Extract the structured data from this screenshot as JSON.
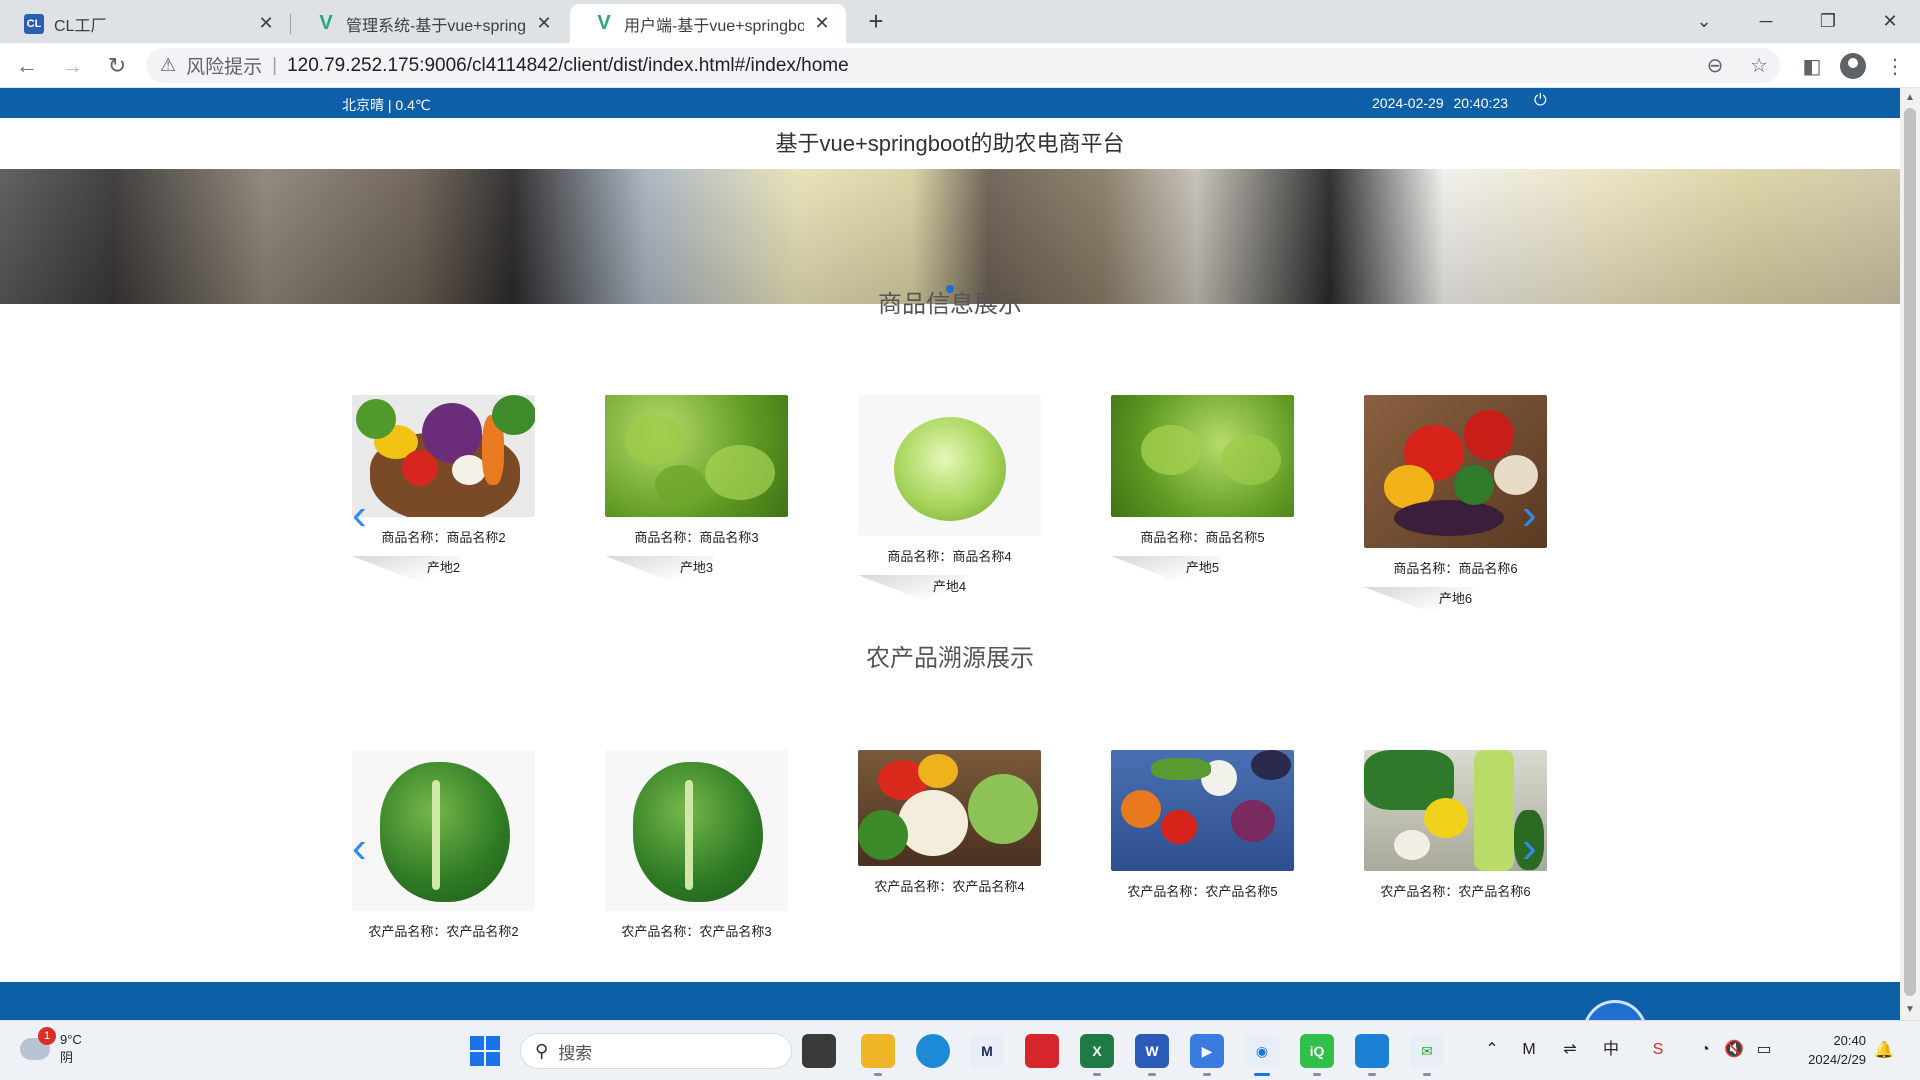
{
  "browser": {
    "tabs": [
      {
        "title": "CL工厂",
        "icon": "cl-logo-icon",
        "active": false
      },
      {
        "title": "管理系统-基于vue+springbo",
        "icon": "vue-logo-icon",
        "active": false
      },
      {
        "title": "用户端-基于vue+springboot",
        "icon": "vue-logo-icon",
        "active": true
      }
    ],
    "warning_label": "风险提示",
    "url": "120.79.252.175:9006/cl4114842/client/dist/index.html#/index/home"
  },
  "page": {
    "weather": "北京晴 | 0.4℃",
    "date": "2024-02-29",
    "time": "20:40:23",
    "site_title": "基于vue+springboot的助农电商平台",
    "products_section": {
      "title": "商品信息展示",
      "items": [
        {
          "name": "商品名称：商品名称2",
          "origin": "产地2"
        },
        {
          "name": "商品名称：商品名称3",
          "origin": "产地3"
        },
        {
          "name": "商品名称：商品名称4",
          "origin": "产地4"
        },
        {
          "name": "商品名称：商品名称5",
          "origin": "产地5"
        },
        {
          "name": "商品名称：商品名称6",
          "origin": "产地6"
        }
      ]
    },
    "trace_section": {
      "title": "农产品溯源展示",
      "items": [
        {
          "name": "农产品名称：农产品名称2"
        },
        {
          "name": "农产品名称：农产品名称3"
        },
        {
          "name": "农产品名称：农产品名称4"
        },
        {
          "name": "农产品名称：农产品名称5"
        },
        {
          "name": "农产品名称：农产品名称6"
        }
      ]
    }
  },
  "taskbar": {
    "weather_temp": "9°C",
    "weather_desc": "阴",
    "weather_badge": "1",
    "search_placeholder": "搜索",
    "time": "20:40",
    "date": "2024/2/29"
  },
  "colors": {
    "brand_blue": "#0d5fa8",
    "arrow_blue": "#2f8bf0"
  }
}
